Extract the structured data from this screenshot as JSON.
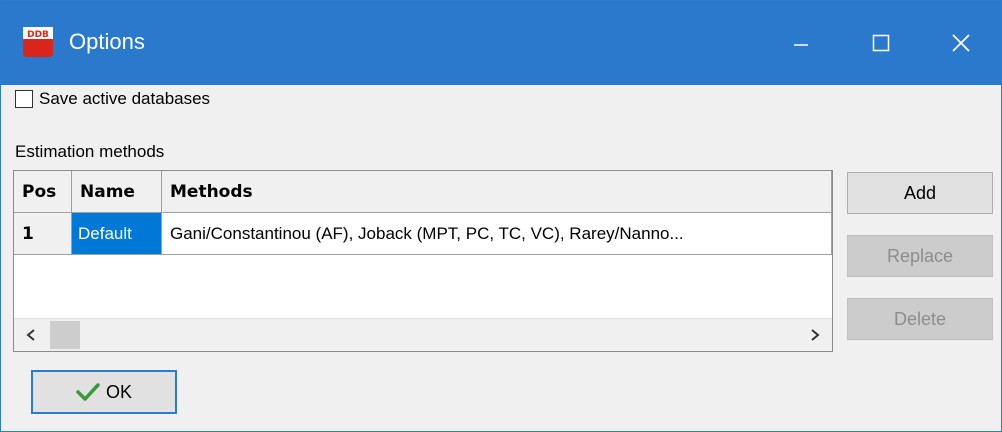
{
  "window": {
    "title": "Options",
    "app_icon": "ddb-app-icon",
    "app_icon_text": "DDB",
    "controls": {
      "minimize": "minimize-icon",
      "maximize": "maximize-icon",
      "close": "close-icon"
    },
    "title_bar_color": "#2b79cc"
  },
  "save_active": {
    "label": "Save active databases",
    "checked": false
  },
  "estimation": {
    "label": "Estimation methods",
    "columns": [
      "Pos",
      "Name",
      "Methods"
    ],
    "rows": [
      {
        "pos": "1",
        "name": "Default",
        "methods": "Gani/Constantinou (AF), Joback (MPT, PC, TC, VC), Rarey/Nanno..."
      }
    ],
    "scroll_left": "‹",
    "scroll_right": "›"
  },
  "buttons": {
    "add": "Add",
    "replace": "Replace",
    "delete": "Delete",
    "ok": "OK"
  },
  "colors": {
    "selection": "#0078d7",
    "ok_check": "#3a9a3a"
  }
}
